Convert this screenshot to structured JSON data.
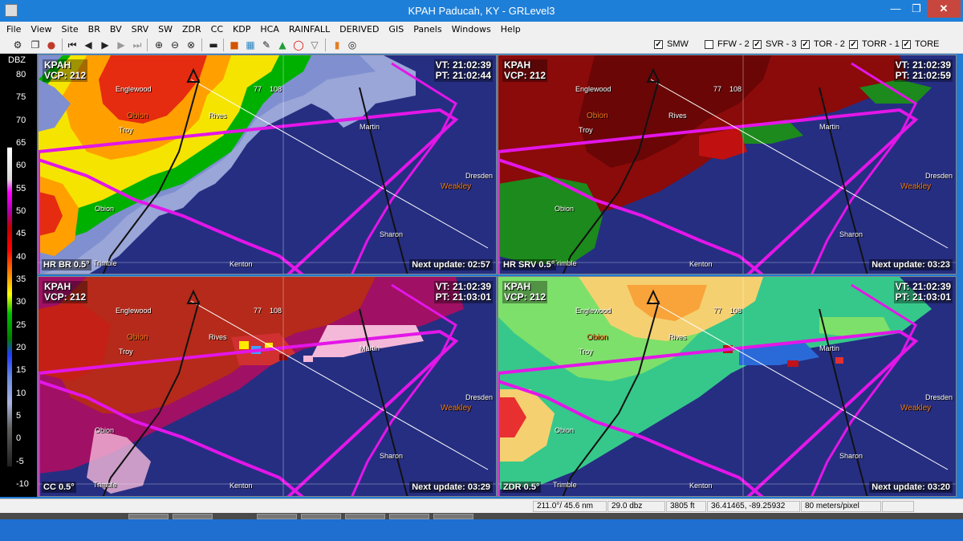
{
  "window": {
    "title": "KPAH Paducah, KY - GRLevel3",
    "min_symbol": "—",
    "max_symbol": "❐",
    "close_symbol": "✕"
  },
  "menu": [
    "File",
    "View",
    "Site",
    "BR",
    "BV",
    "SRV",
    "SW",
    "ZDR",
    "CC",
    "KDP",
    "HCA",
    "RAINFALL",
    "DERIVED",
    "GIS",
    "Panels",
    "Windows",
    "Help"
  ],
  "toolbar": {
    "icons": [
      "settings-icon",
      "copy-icon",
      "palette-icon",
      "first-frame-icon",
      "prev-frame-icon",
      "play-icon",
      "next-frame-icon",
      "last-frame-icon",
      "zoom-in-icon",
      "zoom-out-icon",
      "zoom-reset-icon",
      "clear-icon",
      "storm-icon",
      "grid-icon",
      "pin-icon",
      "triangle-icon",
      "circle-icon",
      "filter-icon",
      "orange-box-icon",
      "target-icon"
    ],
    "warnings": [
      {
        "label": "SMW",
        "checked": true
      },
      {
        "label": "FFW - 2",
        "checked": false
      },
      {
        "label": "SVR - 3",
        "checked": true
      },
      {
        "label": "TOR - 2",
        "checked": true
      },
      {
        "label": "TORR - 1",
        "checked": true
      },
      {
        "label": "TORE",
        "checked": true
      }
    ]
  },
  "colorbar": {
    "unit": "DBZ",
    "ticks": [
      "80",
      "75",
      "70",
      "65",
      "60",
      "55",
      "50",
      "45",
      "40",
      "35",
      "30",
      "25",
      "20",
      "15",
      "10",
      "5",
      "0",
      "-5",
      "-10"
    ]
  },
  "panels": [
    {
      "site": "KPAH",
      "vcp": "VCP: 212",
      "vt": "VT: 21:02:39",
      "pt": "PT: 21:02:44",
      "product": "HR BR 0.5°",
      "next": "Next update: 02:57"
    },
    {
      "site": "KPAH",
      "vcp": "VCP: 212",
      "vt": "VT: 21:02:39",
      "pt": "PT: 21:02:59",
      "product": "HR SRV 0.5°",
      "next": "Next update: 03:23"
    },
    {
      "site": "KPAH",
      "vcp": "VCP: 212",
      "vt": "VT: 21:02:39",
      "pt": "PT: 21:03:01",
      "product": "CC 0.5°",
      "next": "Next update: 03:29"
    },
    {
      "site": "KPAH",
      "vcp": "VCP: 212",
      "vt": "VT: 21:02:39",
      "pt": "PT: 21:03:01",
      "product": "ZDR 0.5°",
      "next": "Next update: 03:20"
    }
  ],
  "places": {
    "englewood": "Englewood",
    "obion_county": "Obion",
    "troy": "Troy",
    "rives": "Rives",
    "martin": "Martin",
    "dresden": "Dresden",
    "weakley": "Weakley",
    "obion": "Obion",
    "sharon": "Sharon",
    "trimble": "Trimble",
    "kenton": "Kenton",
    "route_77": "77",
    "route_108": "108"
  },
  "status": {
    "azimuth": "211.0°/ 45.6 nm",
    "value": "29.0 dbz",
    "height": "3805 ft",
    "coords": "36.41465, -89.25932",
    "resolution": "80 meters/pixel"
  },
  "colors": {
    "bg_blue": "#262e82",
    "warning_magenta": "#e316e8",
    "county_orange": "#f07a1e"
  }
}
